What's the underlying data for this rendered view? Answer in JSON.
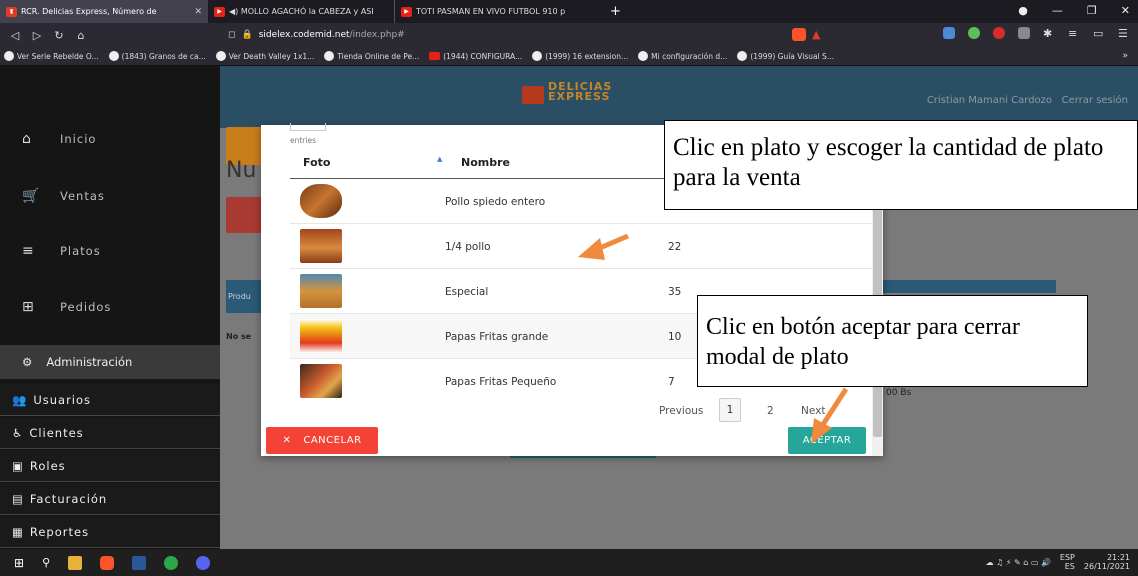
{
  "tabs": [
    {
      "title": "RCR. Delicias Express, Número de"
    },
    {
      "title": "◀) MOLLO AGACHÓ la CABEZA y ASI"
    },
    {
      "title": "TOTI PASMAN EN VIVO FUTBOL 910 p"
    }
  ],
  "newtab": "+",
  "address": {
    "host": "sidelex.codemid.net",
    "path": "/index.php#"
  },
  "bookmarks": [
    "Ver Serie Rebelde O...",
    "(1843) Granos de ca...",
    "Ver Death Valley 1x1...",
    "Tienda Online de Pe...",
    "(1944) CONFIGURA...",
    "(1999) 16 extension...",
    "Mi configuración d...",
    "(1999) Guía Visual S..."
  ],
  "bookmarks_more": "»",
  "app": {
    "brand_line1": "DELICIAS",
    "brand_line2": "EXPRESS",
    "user": "Cristian Mamani Cardozo",
    "logout": "Cerrar sesión",
    "page_title_partial": "Nu",
    "bg_label1": "Produ",
    "bg_label2": "No se",
    "bg_total": "00 Bs"
  },
  "sidebar": {
    "items": [
      {
        "label": "Inicio",
        "icon": "⌂"
      },
      {
        "label": "Ventas",
        "icon": "🛒"
      },
      {
        "label": "Platos",
        "icon": "≡"
      },
      {
        "label": "Pedidos",
        "icon": "⊞"
      }
    ],
    "admin": {
      "label": "Administración",
      "icon": "⚙"
    },
    "subitems": [
      {
        "label": "Usuarios",
        "icon": "👥"
      },
      {
        "label": "Clientes",
        "icon": "♿"
      },
      {
        "label": "Roles",
        "icon": "▣"
      },
      {
        "label": "Facturación",
        "icon": "▤"
      },
      {
        "label": "Reportes",
        "icon": "▦"
      }
    ]
  },
  "modal": {
    "entries_label": "entries",
    "columns": {
      "foto": "Foto",
      "nombre": "Nombre"
    },
    "rows": [
      {
        "name": "Pollo spiedo entero",
        "value": ""
      },
      {
        "name": "1/4 pollo",
        "value": "22"
      },
      {
        "name": "Especial",
        "value": "35"
      },
      {
        "name": "Papas Fritas grande",
        "value": "10"
      },
      {
        "name": "Papas Fritas Pequeño",
        "value": "7"
      }
    ],
    "pagination": {
      "previous": "Previous",
      "page1": "1",
      "page2": "2",
      "next": "Next"
    },
    "cancel_label": "CANCELAR",
    "accept_label": "ACEPTAR"
  },
  "callouts": {
    "top": "Clic en plato y escoger la cantidad de plato para la venta",
    "bottom": "Clic en botón aceptar para cerrar modal de plato"
  },
  "taskbar": {
    "lang1": "ESP",
    "lang2": "ES",
    "time": "21:21",
    "date": "26/11/2021"
  },
  "colors": {
    "accent_teal": "#26a69a",
    "cancel_red": "#f44336",
    "arrow_orange": "#f08a3c",
    "header_blue": "#2a4e63"
  }
}
